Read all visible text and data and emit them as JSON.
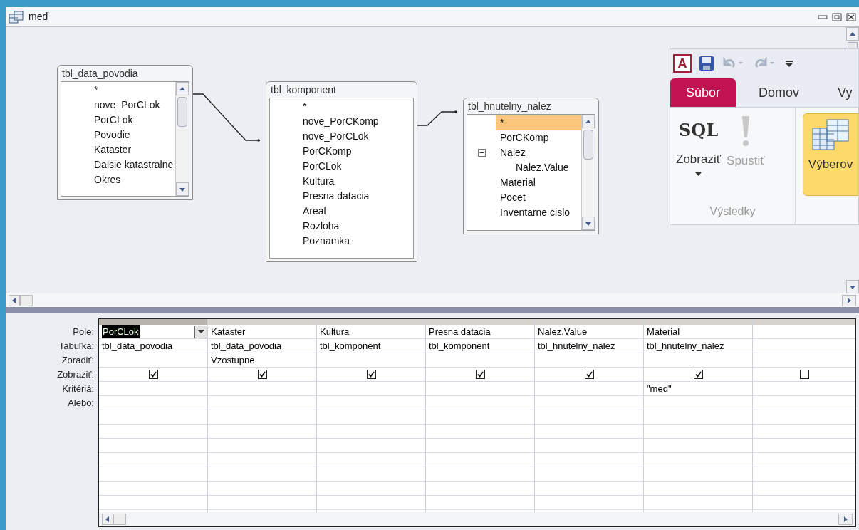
{
  "window": {
    "title": "meď"
  },
  "tables": [
    {
      "title": "tbl_data_povodia",
      "scrollbar": true,
      "fields": [
        {
          "name": "*",
          "selected": false
        },
        {
          "name": "nove_PorCLok",
          "selected": false
        },
        {
          "name": "PorCLok",
          "selected": false
        },
        {
          "name": "Povodie",
          "selected": false
        },
        {
          "name": "Kataster",
          "selected": false
        },
        {
          "name": "Dalsie katastralne",
          "selected": false
        },
        {
          "name": "Okres",
          "selected": false
        }
      ]
    },
    {
      "title": "tbl_komponent",
      "scrollbar": false,
      "fields": [
        {
          "name": "*",
          "selected": false
        },
        {
          "name": "nove_PorCKomp",
          "selected": false
        },
        {
          "name": "nove_PorCLok",
          "selected": false
        },
        {
          "name": "PorCKomp",
          "selected": false
        },
        {
          "name": "PorCLok",
          "selected": false
        },
        {
          "name": "Kultura",
          "selected": false
        },
        {
          "name": "Presna datacia",
          "selected": false
        },
        {
          "name": "Areal",
          "selected": false
        },
        {
          "name": "Rozloha",
          "selected": false
        },
        {
          "name": "Poznamka",
          "selected": false
        }
      ]
    },
    {
      "title": "tbl_hnutelny_nalez",
      "scrollbar": true,
      "fields": [
        {
          "name": "*",
          "selected": true
        },
        {
          "name": "PorCKomp",
          "selected": false
        },
        {
          "name": "Nalez",
          "selected": false,
          "expanded": true,
          "children": [
            {
              "name": "Nalez.Value",
              "selected": false
            }
          ]
        },
        {
          "name": "Material",
          "selected": false
        },
        {
          "name": "Pocet",
          "selected": false
        },
        {
          "name": "Inventarne cislo",
          "selected": false
        }
      ]
    }
  ],
  "ribbon": {
    "app_logo": "A",
    "tabs": [
      {
        "label": "Súbor",
        "selected": true
      },
      {
        "label": "Domov",
        "selected": false
      },
      {
        "label": "Vy",
        "selected": false
      }
    ],
    "buttons": [
      {
        "kind": "sql",
        "icon_text": "SQL",
        "label": "Zobraziť",
        "disabled": false,
        "selected": false
      },
      {
        "kind": "run",
        "label": "Spustiť",
        "disabled": true,
        "selected": false
      },
      {
        "kind": "select",
        "label": "Výberov",
        "disabled": false,
        "selected": true
      }
    ],
    "group_label": "Výsledky"
  },
  "grid": {
    "row_labels": [
      "Pole:",
      "Tabuľka:",
      "Zoradiť:",
      "Zobraziť:",
      "Kritériá:",
      "Alebo:"
    ],
    "columns": [
      {
        "field": "PorCLok",
        "table": "tbl_data_povodia",
        "show": true,
        "selected": true
      },
      {
        "field": "Kataster",
        "table": "tbl_data_povodia",
        "sort": "Vzostupne",
        "show": true,
        "selected": false
      },
      {
        "field": "Kultura",
        "table": "tbl_komponent",
        "show": true,
        "selected": false
      },
      {
        "field": "Presna datacia",
        "table": "tbl_komponent",
        "show": true,
        "selected": false
      },
      {
        "field": "Nalez.Value",
        "table": "tbl_hnutelny_nalez",
        "show": true,
        "selected": false
      },
      {
        "field": "Material",
        "table": "tbl_hnutelny_nalez",
        "show": true,
        "criteria": "\"med\"",
        "selected": false
      },
      {
        "show": false,
        "selected": false
      }
    ]
  }
}
